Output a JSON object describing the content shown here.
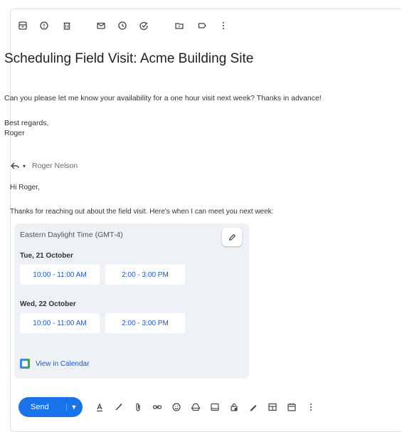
{
  "email": {
    "subject": "Scheduling Field Visit: Acme Building Site",
    "body": "Can you please let me know your availability for a one hour visit next week? Thanks in advance!",
    "closing": "Best regards,",
    "signature": "Roger"
  },
  "reply": {
    "recipient": "Roger Nelson",
    "greeting": "Hi Roger,",
    "message": "Thanks for reaching out about the field visit. Here's when I can meet you next week:",
    "timezone": "Eastern Daylight Time (GMT-4)",
    "days": [
      {
        "date": "Tue, 21 October",
        "slots": [
          "10:00 - 11:00 AM",
          "2:00 - 3:00 PM"
        ]
      },
      {
        "date": "Wed, 22 October",
        "slots": [
          "10:00 - 11:00 AM",
          "2:00 - 3:00 PM"
        ]
      }
    ],
    "calendar_link": "View in Calendar"
  },
  "compose": {
    "send_label": "Send"
  },
  "toolbar_icons": [
    "archive-icon",
    "report-spam-icon",
    "delete-icon",
    "mark-unread-icon",
    "snooze-icon",
    "add-to-tasks-icon",
    "move-to-icon",
    "label-icon",
    "more-options-icon"
  ],
  "compose_icons": [
    "formatting-icon",
    "ai-write-icon",
    "attach-icon",
    "link-icon",
    "emoji-icon",
    "drive-icon",
    "photo-icon",
    "lock-icon",
    "signature-icon",
    "layout-icon",
    "schedule-icon",
    "more-icon"
  ],
  "colors": {
    "accent": "#1a73e8",
    "link": "#1a57c9",
    "card": "#eef1f6"
  }
}
